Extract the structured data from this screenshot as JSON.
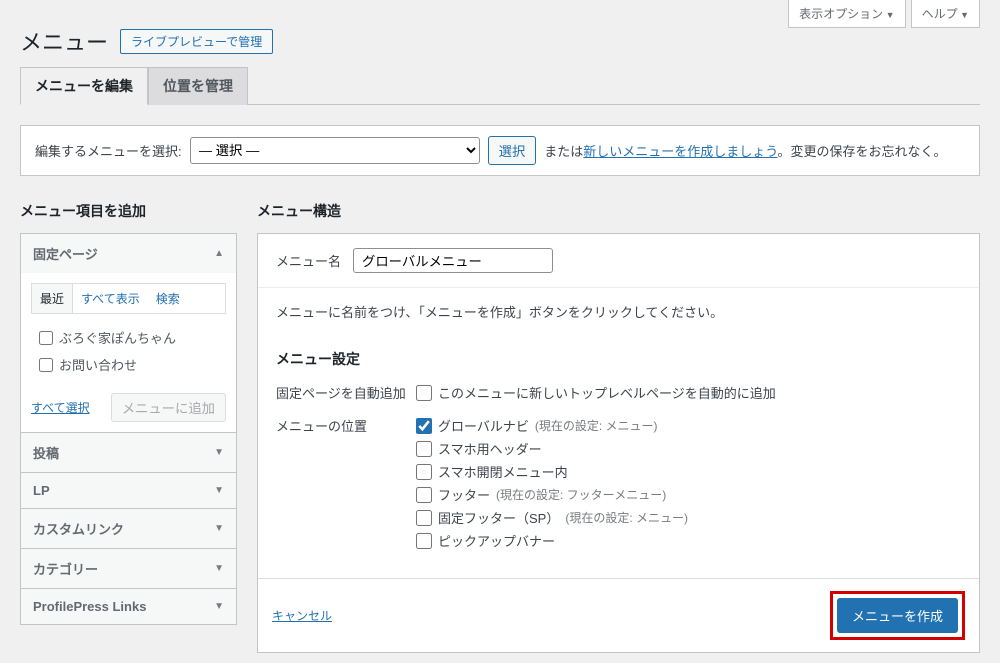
{
  "screen_meta": {
    "options": "表示オプション",
    "help": "ヘルプ"
  },
  "header": {
    "title": "メニュー",
    "live_preview_btn": "ライブプレビューで管理"
  },
  "tabs": {
    "edit": "メニューを編集",
    "locations": "位置を管理"
  },
  "selector": {
    "label": "編集するメニューを選択:",
    "placeholder": "— 選択 —",
    "choose_btn": "選択",
    "or_text": "または",
    "create_link": "新しいメニューを作成しましょう",
    "suffix": "。変更の保存をお忘れなく。"
  },
  "left": {
    "heading": "メニュー項目を追加",
    "acc_fixed_page": "固定ページ",
    "acc_post": "投稿",
    "acc_lp": "LP",
    "acc_custom": "カスタムリンク",
    "acc_category": "カテゴリー",
    "acc_ppress": "ProfilePress Links",
    "sub_tabs": {
      "recent": "最近",
      "all": "すべて表示",
      "search": "検索"
    },
    "page_items": [
      "ぶろぐ家ぽんちゃん",
      "お問い合わせ"
    ],
    "select_all": "すべて選択",
    "add_btn": "メニューに追加"
  },
  "right": {
    "heading": "メニュー構造",
    "name_label": "メニュー名",
    "name_value": "グローバルメニュー",
    "instructions": "メニューに名前をつけ、「メニューを作成」ボタンをクリックしてください。",
    "settings_heading": "メニュー設定",
    "auto_add_label": "固定ページを自動追加",
    "auto_add_option": "このメニューに新しいトップレベルページを自動的に追加",
    "location_label": "メニューの位置",
    "locations": [
      {
        "label": "グローバルナビ",
        "hint": "(現在の設定: メニュー)",
        "checked": true
      },
      {
        "label": "スマホ用ヘッダー",
        "hint": "",
        "checked": false
      },
      {
        "label": "スマホ開閉メニュー内",
        "hint": "",
        "checked": false
      },
      {
        "label": "フッター",
        "hint": "(現在の設定: フッターメニュー)",
        "checked": false
      },
      {
        "label": "固定フッター（SP）",
        "hint": "(現在の設定: メニュー)",
        "checked": false
      },
      {
        "label": "ピックアップバナー",
        "hint": "",
        "checked": false
      }
    ],
    "cancel": "キャンセル",
    "create_btn": "メニューを作成"
  }
}
